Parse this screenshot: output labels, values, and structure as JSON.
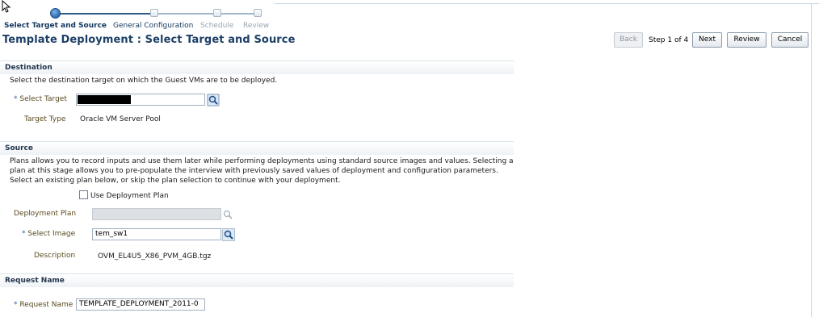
{
  "train": {
    "steps": [
      {
        "label": "Select Target and Source"
      },
      {
        "label": "General Configuration"
      },
      {
        "label": "Schedule"
      },
      {
        "label": "Review"
      }
    ]
  },
  "page": {
    "title": "Template Deployment : Select Target and Source"
  },
  "toolbar": {
    "back_label": "Back",
    "step_text": "Step 1 of 4",
    "next_label": "Next",
    "review_label": "Review",
    "cancel_label": "Cancel"
  },
  "destination": {
    "header": "Destination",
    "description": "Select the destination target on which the Guest VMs are to be deployed.",
    "required_mark": "*",
    "select_target_label": "Select Target",
    "target_type_label": "Target Type",
    "target_type_value": "Oracle VM Server Pool"
  },
  "source": {
    "header": "Source",
    "description_line1": "Plans allows you to record inputs and use them later while performing deployments using standard source images and values. Selecting a",
    "description_line2": "plan at this stage allows you to pre-populate the interview with previously saved values of deployment and configuration parameters.",
    "description_line3": "Select an existing plan below, or skip the plan selection to continue with your deployment.",
    "use_plan_label": "Use Deployment Plan",
    "deployment_plan_label": "Deployment Plan",
    "select_image_label": "Select Image",
    "select_image_value": "tem_sw1",
    "description_label": "Description",
    "description_value": "OVM_EL4U5_X86_PVM_4GB.tgz"
  },
  "request": {
    "header": "Request Name",
    "label": "Request Name",
    "value": "TEMPLATE_DEPLOYMENT_2011-0"
  },
  "icons": {
    "search": "search-icon",
    "cursor": "mouse-cursor-icon"
  },
  "colors": {
    "accent": "#1d3f66",
    "train_active": "#2a6ab0",
    "label": "#5a4a1e",
    "required": "#2a5fa3"
  }
}
